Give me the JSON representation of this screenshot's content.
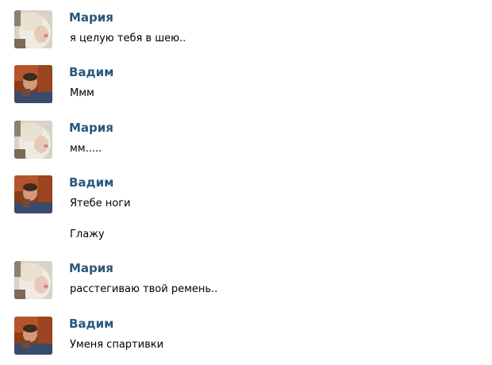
{
  "messages": [
    {
      "author": "Мария",
      "avatar": "female-avatar",
      "texts": [
        "я целую тебя в шею.."
      ]
    },
    {
      "author": "Вадим",
      "avatar": "male-avatar",
      "texts": [
        "Ммм"
      ]
    },
    {
      "author": "Мария",
      "avatar": "female-avatar",
      "texts": [
        "мм....."
      ]
    },
    {
      "author": "Вадим",
      "avatar": "male-avatar",
      "texts": [
        "Ятебе ноги",
        "Глажу"
      ]
    },
    {
      "author": "Мария",
      "avatar": "female-avatar",
      "texts": [
        "расстегиваю твой ремень.."
      ]
    },
    {
      "author": "Вадим",
      "avatar": "male-avatar",
      "texts": [
        "Уменя спартивки"
      ]
    }
  ],
  "colors": {
    "author_name": "#2b587a",
    "message_text": "#000000",
    "background": "#ffffff"
  }
}
